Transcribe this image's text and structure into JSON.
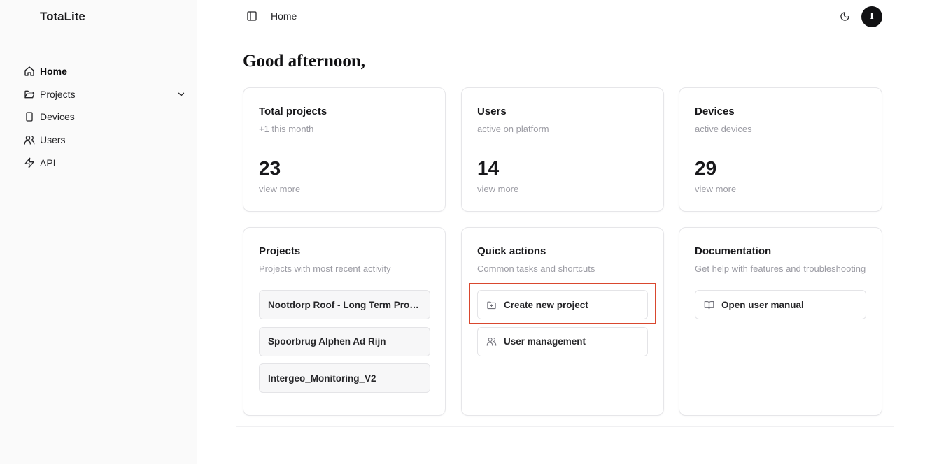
{
  "brand": "TotaLite",
  "sidebar": {
    "items": [
      {
        "label": "Home",
        "icon": "home-icon"
      },
      {
        "label": "Projects",
        "icon": "folder-open-icon"
      },
      {
        "label": "Devices",
        "icon": "device-icon"
      },
      {
        "label": "Users",
        "icon": "users-icon"
      },
      {
        "label": "API",
        "icon": "zap-icon"
      }
    ]
  },
  "header": {
    "breadcrumb": "Home",
    "avatar_initial": "I"
  },
  "greeting": "Good afternoon,",
  "stats": [
    {
      "title": "Total projects",
      "subtitle": "+1 this month",
      "value": "23",
      "link": "view more"
    },
    {
      "title": "Users",
      "subtitle": "active on platform",
      "value": "14",
      "link": "view more"
    },
    {
      "title": "Devices",
      "subtitle": "active devices",
      "value": "29",
      "link": "view more"
    }
  ],
  "projects_card": {
    "title": "Projects",
    "subtitle": "Projects with most recent activity",
    "items": [
      "Nootdorp Roof - Long Term Productie...",
      "Spoorbrug Alphen Ad Rijn",
      "Intergeo_Monitoring_V2"
    ]
  },
  "quick_actions": {
    "title": "Quick actions",
    "subtitle": "Common tasks and shortcuts",
    "items": [
      {
        "label": "Create new project",
        "icon": "folder-plus-icon"
      },
      {
        "label": "User management",
        "icon": "users-icon"
      }
    ]
  },
  "documentation": {
    "title": "Documentation",
    "subtitle": "Get help with features and troubleshooting",
    "items": [
      {
        "label": "Open user manual",
        "icon": "book-open-icon"
      }
    ]
  },
  "colors": {
    "highlight": "#d9472e",
    "avatar_bg": "#111113",
    "muted_text": "#9b9ba3"
  }
}
